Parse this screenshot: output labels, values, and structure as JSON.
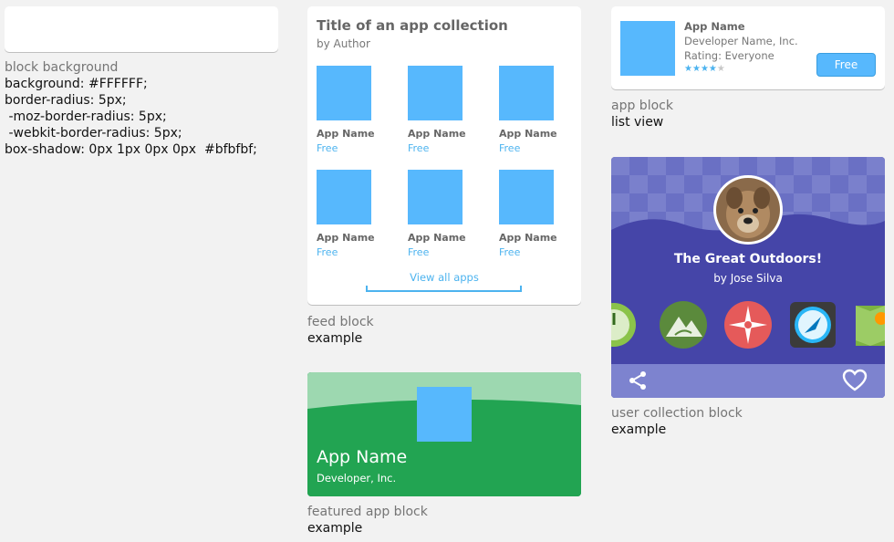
{
  "block_background": {
    "caption_sub": "block background",
    "css_lines": [
      "background: #FFFFFF;",
      "border-radius: 5px;",
      " -moz-border-radius: 5px;",
      " -webkit-border-radius: 5px;",
      "box-shadow: 0px 1px 0px 0px  #bfbfbf;"
    ]
  },
  "feed_block": {
    "title": "Title of an app collection",
    "author": "by Author",
    "apps": [
      {
        "name": "App Name",
        "price": "Free"
      },
      {
        "name": "App Name",
        "price": "Free"
      },
      {
        "name": "App Name",
        "price": "Free"
      },
      {
        "name": "App Name",
        "price": "Free"
      },
      {
        "name": "App Name",
        "price": "Free"
      },
      {
        "name": "App Name",
        "price": "Free"
      }
    ],
    "view_all": "View all apps",
    "caption_sub": "feed block",
    "caption_main": "example"
  },
  "featured_app_block": {
    "app_name": "App Name",
    "developer": "Developer, Inc.",
    "caption_sub": "featured app block",
    "caption_main": "example"
  },
  "app_block": {
    "app_name": "App Name",
    "developer": "Developer Name, Inc.",
    "rating_text": "Rating: Everyone",
    "stars": 4,
    "stars_max": 5,
    "button_label": "Free",
    "caption_sub": "app block",
    "caption_main": "list view"
  },
  "user_collection_block": {
    "title": "The Great Outdoors!",
    "author": "by Jose Silva",
    "app_icons": [
      "stopwatch-icon",
      "mountain-trail-icon",
      "compass-rose-icon",
      "navigation-compass-icon",
      "map-pin-icon"
    ],
    "caption_sub": "user collection block",
    "caption_main": "example"
  },
  "colors": {
    "accent_blue": "#57b8fd",
    "link_blue": "#4cb3ef",
    "featured_green": "#22a452",
    "collection_purple": "#4545a8"
  }
}
